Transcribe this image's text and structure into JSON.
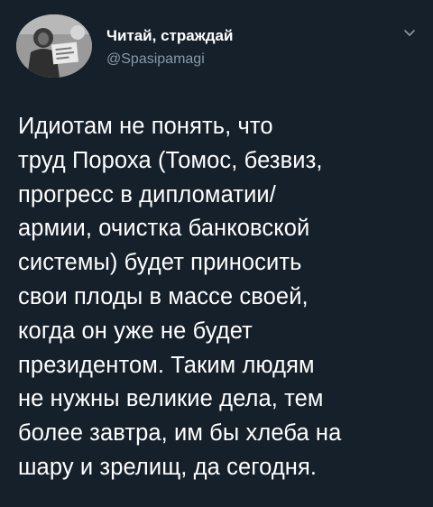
{
  "author": {
    "display_name": "Читай, страждай",
    "handle": "@Spasipamagi",
    "avatar_icon": "avatar-image"
  },
  "menu": {
    "caret_icon": "chevron-down-icon"
  },
  "tweet": {
    "lines": [
      "Идиотам не понять, что",
      "труд Пороха (Томос, безвиз,",
      "прогресс в дипломатии/",
      "армии, очистка банковской",
      "системы) будет приносить",
      "свои плоды в массе своей,",
      "когда он уже не будет",
      "президентом. Таким людям",
      "не нужны великие дела, тем",
      "более завтра, им бы хлеба на",
      "шару и зрелищ, да сегодня."
    ]
  },
  "colors": {
    "background": "#15202b",
    "text": "#ffffff",
    "secondary_text": "#8899a6"
  }
}
